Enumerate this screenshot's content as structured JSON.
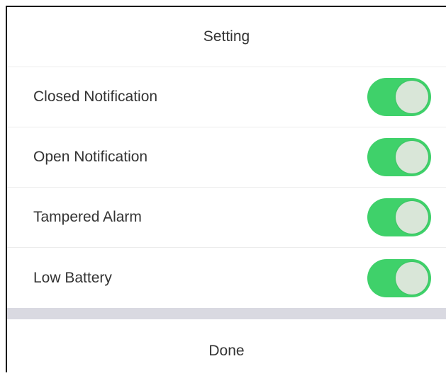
{
  "title": "Setting",
  "accent_color": "#3fd16a",
  "knob_color": "#d9e6d8",
  "settings": [
    {
      "label": "Closed Notification",
      "enabled": true
    },
    {
      "label": "Open Notification",
      "enabled": true
    },
    {
      "label": "Tampered Alarm",
      "enabled": true
    },
    {
      "label": "Low Battery",
      "enabled": true
    }
  ],
  "done_label": "Done"
}
